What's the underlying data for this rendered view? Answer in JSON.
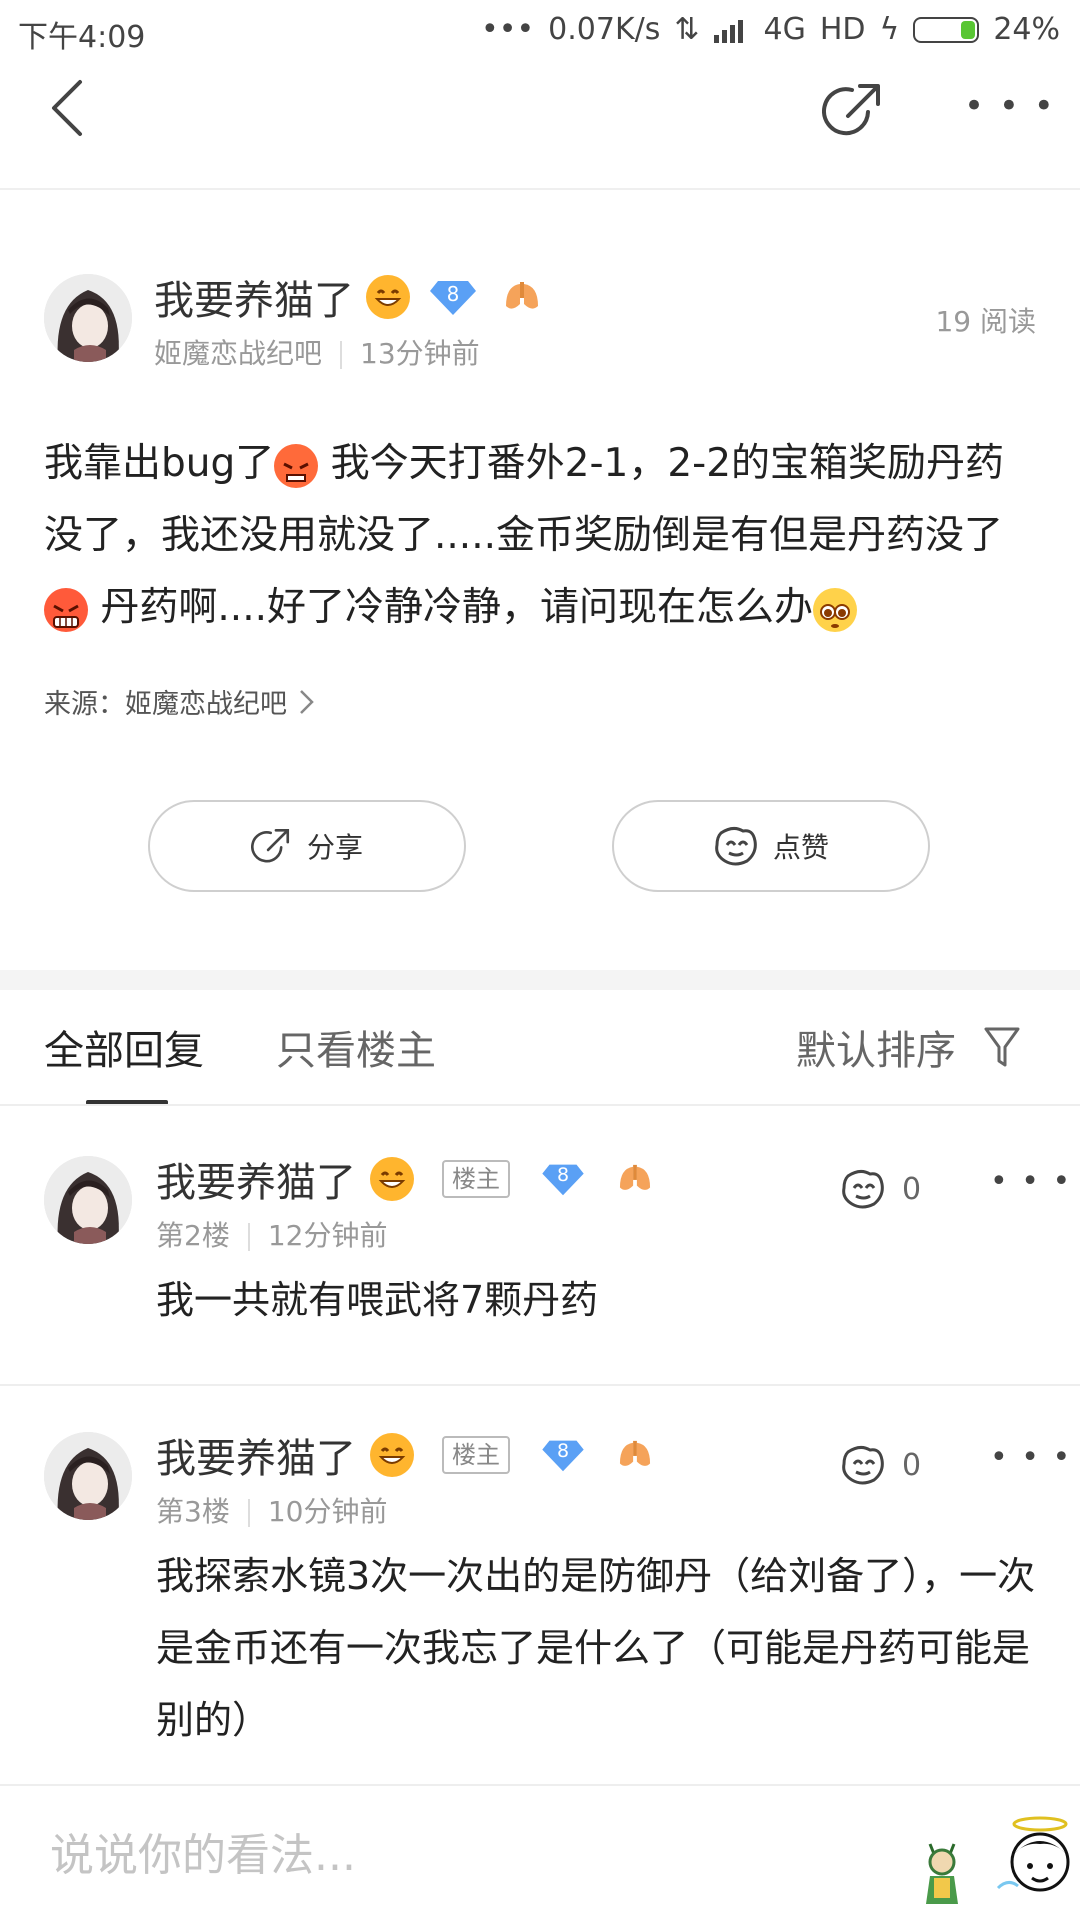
{
  "status_bar": {
    "time": "下午4:09",
    "dots": "•••",
    "speed": "0.07K/s",
    "network": "4G",
    "hd": "HD",
    "battery": "24%",
    "battery_level": 0.24,
    "battery_color": "#59c634"
  },
  "nav": {
    "back_icon": "chevron-left",
    "share_icon": "share-arrow",
    "more_icon": "more-dots",
    "more_text": "• • •"
  },
  "post": {
    "author": "我要养猫了",
    "level": "8",
    "forum": "姬魔恋战纪吧",
    "time": "13分钟前",
    "reads": "19 阅读",
    "text_1": "我靠出bug了",
    "text_2": " 我今天打番外2-1，2-2的宝箱奖励丹药没了，我还没用就没了.....金币奖励倒是有但是丹药没了",
    "text_3": " 丹药啊....好了冷静冷静，请问现在怎么办",
    "source_label": "来源：",
    "source_forum": "姬魔恋战纪吧",
    "share_label": "分享",
    "like_label": "点赞"
  },
  "tabs": {
    "all": "全部回复",
    "owner_only": "只看楼主",
    "sort": "默认排序"
  },
  "replies": [
    {
      "author": "我要养猫了",
      "tag": "楼主",
      "level": "8",
      "floor": "第2楼",
      "time": "12分钟前",
      "likes": "0",
      "text": "我一共就有喂武将7颗丹药"
    },
    {
      "author": "我要养猫了",
      "tag": "楼主",
      "level": "8",
      "floor": "第3楼",
      "time": "10分钟前",
      "likes": "0",
      "text": "我探索水镜3次一次出的是防御丹（给刘备了），一次是金币还有一次我忘了是什么了（可能是丹药可能是别的）"
    }
  ],
  "comment": {
    "placeholder": "说说你的看法..."
  },
  "colors": {
    "accent_blue": "#5aa0f5",
    "badge_orange": "#f5a35a",
    "text_gray": "#999999"
  }
}
